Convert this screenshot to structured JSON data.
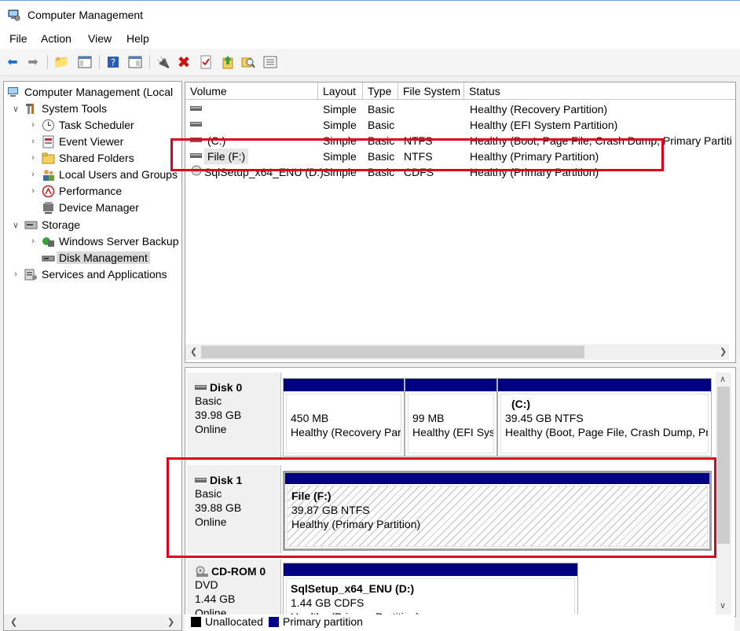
{
  "window": {
    "title": "Computer Management"
  },
  "menu": [
    "File",
    "Action",
    "View",
    "Help"
  ],
  "tree": {
    "root": "Computer Management (Local",
    "system_tools": "System Tools",
    "task_scheduler": "Task Scheduler",
    "event_viewer": "Event Viewer",
    "shared_folders": "Shared Folders",
    "local_users": "Local Users and Groups",
    "performance": "Performance",
    "device_manager": "Device Manager",
    "storage": "Storage",
    "wsb": "Windows Server Backup",
    "disk_management": "Disk Management",
    "services": "Services and Applications"
  },
  "volumes": {
    "headers": [
      "Volume",
      "Layout",
      "Type",
      "File System",
      "Status"
    ],
    "rows": [
      {
        "volume": "",
        "layout": "Simple",
        "type": "Basic",
        "fs": "",
        "status": "Healthy (Recovery Partition)"
      },
      {
        "volume": "",
        "layout": "Simple",
        "type": "Basic",
        "fs": "",
        "status": "Healthy (EFI System Partition)"
      },
      {
        "volume": "(C:)",
        "layout": "Simple",
        "type": "Basic",
        "fs": "NTFS",
        "status": "Healthy (Boot, Page File, Crash Dump, Primary Partiti"
      },
      {
        "volume": "File (F:)",
        "layout": "Simple",
        "type": "Basic",
        "fs": "NTFS",
        "status": "Healthy (Primary Partition)"
      },
      {
        "volume": "SqlSetup_x64_ENU (D:)",
        "layout": "Simple",
        "type": "Basic",
        "fs": "CDFS",
        "status": "Healthy (Primary Partition)"
      }
    ]
  },
  "disks": {
    "disk0": {
      "name": "Disk 0",
      "type": "Basic",
      "size": "39.98 GB",
      "state": "Online"
    },
    "disk0_parts": [
      {
        "l1": "450 MB",
        "l2": "Healthy (Recovery Par"
      },
      {
        "l1": "99 MB",
        "l2": "Healthy (EFI Sys"
      },
      {
        "title": "(C:)",
        "l1": "39.45 GB NTFS",
        "l2": "Healthy (Boot, Page File, Crash Dump, Pr"
      }
    ],
    "disk1": {
      "name": "Disk 1",
      "type": "Basic",
      "size": "39.88 GB",
      "state": "Online"
    },
    "disk1_part": {
      "title": "File  (F:)",
      "l1": "39.87 GB NTFS",
      "l2": "Healthy (Primary Partition)"
    },
    "cdrom": {
      "name": "CD-ROM 0",
      "type": "DVD",
      "size": "1.44 GB",
      "state": "Online"
    },
    "cdrom_part": {
      "title": "SqlSetup_x64_ENU  (D:)",
      "l1": "1.44 GB CDFS",
      "l2": "Healthy (Primary Partition)"
    }
  },
  "legend": {
    "unallocated": "Unallocated",
    "primary": "Primary partition"
  },
  "colors": {
    "primary_partition": "#000080",
    "unallocated": "#000000",
    "highlight": "#e0001b"
  }
}
